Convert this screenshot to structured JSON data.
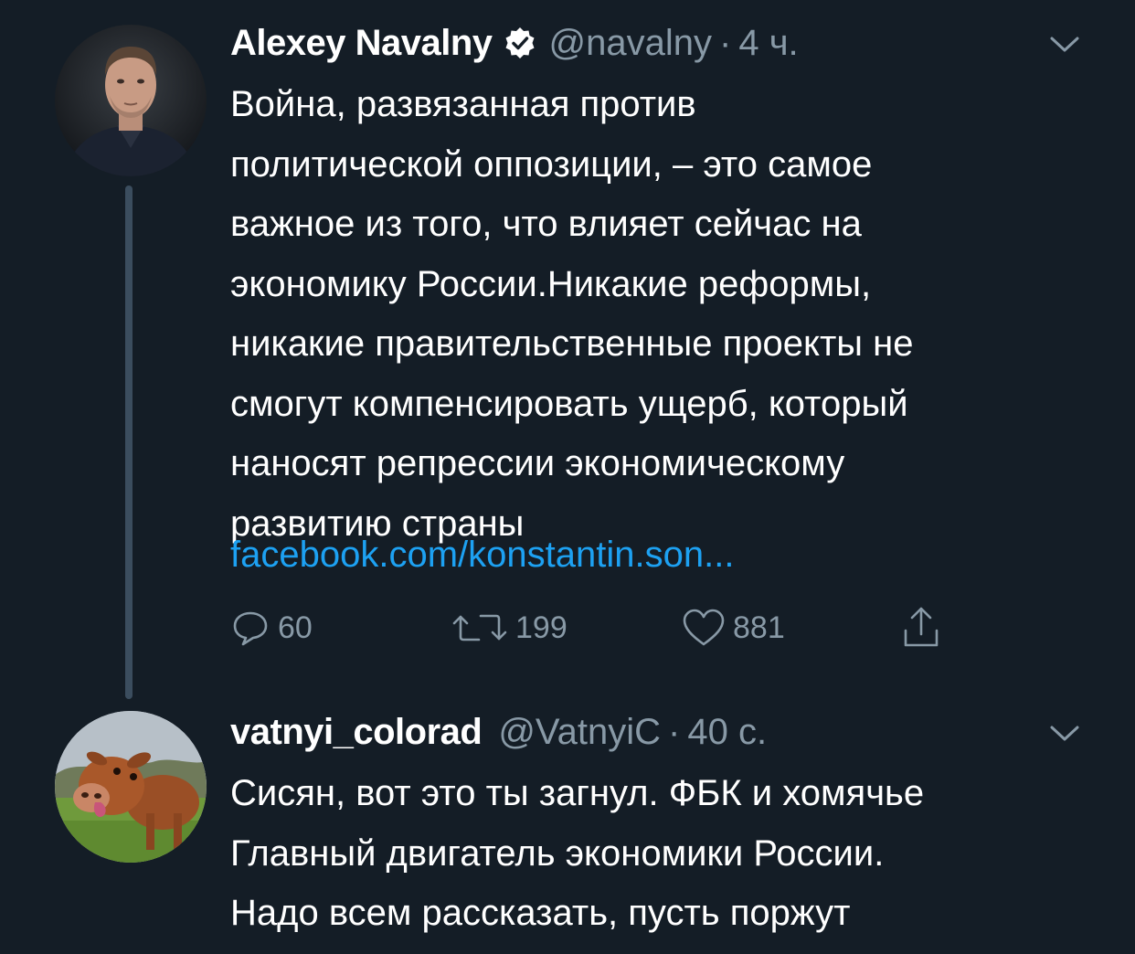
{
  "tweets": [
    {
      "author_name": "Alexey Navalny",
      "verified": true,
      "handle": "@navalny",
      "separator": "·",
      "time": "4 ч.",
      "text": "Война, развязанная против\nполитической оппозиции, – это самое\nважное из того, что влияет сейчас на\nэкономику России.Никакие реформы,\nникакие правительственные проекты не\nсмогут компенсировать ущерб, который\nнаносят репрессии экономическому\nразвитию страны",
      "link": "facebook.com/konstantin.son...",
      "actions": {
        "replies": "60",
        "retweets": "199",
        "likes": "881"
      }
    },
    {
      "author_name": "vatnyi_colorad",
      "verified": false,
      "handle": "@VatnyiC",
      "separator": "·",
      "time": "40 с.",
      "text": "Сисян, вот это ты загнул. ФБК и хомячье\nГлавный двигатель экономики России.\nНадо всем рассказать, пусть поржут"
    }
  ],
  "colors": {
    "background": "#141d26",
    "text": "#ffffff",
    "secondary": "#8899a6",
    "link": "#1da1f2",
    "thread_line": "#3b4d5e"
  }
}
